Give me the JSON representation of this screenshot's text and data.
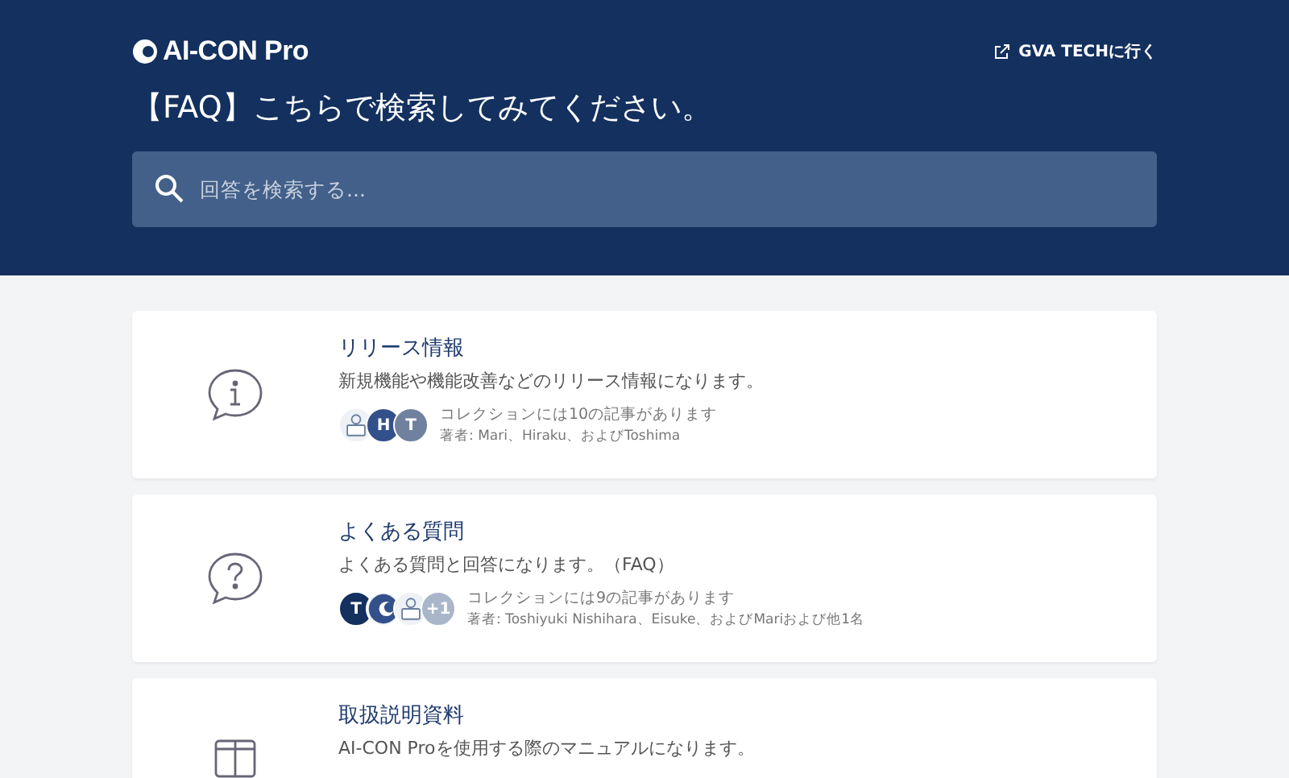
{
  "header": {
    "logo": "AI-CON Pro",
    "external_link": "GVA TECHに行く",
    "title": "【FAQ】こちらで検索してみてください。",
    "search": {
      "placeholder": "回答を検索する..."
    }
  },
  "collections": [
    {
      "kind": "info",
      "title": "リリース情報",
      "description": "新規機能や機能改善などのリリース情報になります。",
      "avatars": [
        {
          "kind": "illustration"
        },
        {
          "kind": "letter",
          "text": "H",
          "color": "#34508a"
        },
        {
          "kind": "letter",
          "text": "T",
          "color": "#6f819f"
        }
      ],
      "count": "コレクションには10の記事があります",
      "authors": "著者: Mari、Hiraku、およびToshima"
    },
    {
      "kind": "question",
      "title": "よくある質問",
      "description": "よくある質問と回答になります。（FAQ）",
      "avatars": [
        {
          "kind": "letter",
          "text": "T",
          "color": "#13305f"
        },
        {
          "kind": "logo"
        },
        {
          "kind": "illustration"
        },
        {
          "kind": "more",
          "text": "+1"
        }
      ],
      "count": "コレクションには9の記事があります",
      "authors": "著者: Toshiyuki Nishihara、Eisuke、およびMariおよび他1名"
    },
    {
      "kind": "manual",
      "title": "取扱説明資料",
      "description": "AI-CON Proを使用する際のマニュアルになります。"
    }
  ]
}
